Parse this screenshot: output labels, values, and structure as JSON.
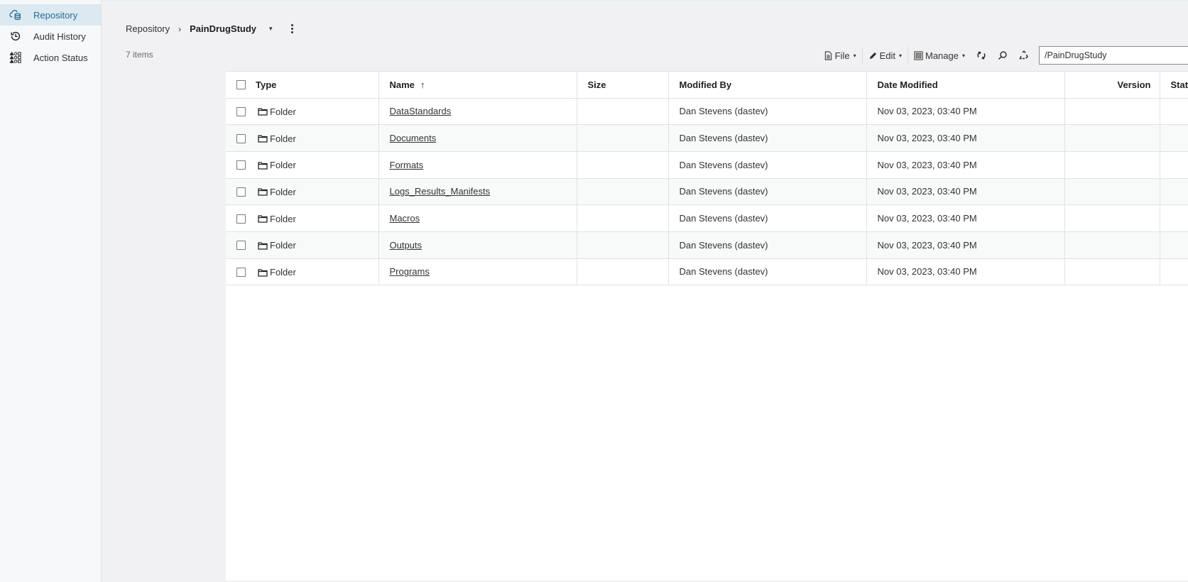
{
  "sidebar": {
    "items": [
      {
        "label": "Repository",
        "icon": "cloud-database-icon",
        "active": true
      },
      {
        "label": "Audit History",
        "icon": "history-icon",
        "active": false
      },
      {
        "label": "Action Status",
        "icon": "action-status-grid-icon",
        "active": false
      }
    ]
  },
  "breadcrumb": {
    "root": "Repository",
    "separator": "›",
    "current": "PainDrugStudy",
    "dropdown_glyph": "▾"
  },
  "item_count": "7 items",
  "toolbar": {
    "file_label": "File",
    "edit_label": "Edit",
    "manage_label": "Manage",
    "caret": "▾",
    "path_value": "/PainDrugStudy",
    "icons": [
      "sync-icon",
      "search-icon",
      "recycle-icon"
    ]
  },
  "table": {
    "columns": {
      "type": "Type",
      "name": "Name",
      "name_sort": "↑",
      "size": "Size",
      "modified_by": "Modified By",
      "date_modified": "Date Modified",
      "version": "Version",
      "status": "Status"
    },
    "rows": [
      {
        "type": "Folder",
        "name": "DataStandards",
        "size": "",
        "modified_by": "Dan Stevens (dastev)",
        "date_modified": "Nov 03, 2023, 03:40 PM",
        "version": "",
        "status": ""
      },
      {
        "type": "Folder",
        "name": "Documents",
        "size": "",
        "modified_by": "Dan Stevens (dastev)",
        "date_modified": "Nov 03, 2023, 03:40 PM",
        "version": "",
        "status": ""
      },
      {
        "type": "Folder",
        "name": "Formats",
        "size": "",
        "modified_by": "Dan Stevens (dastev)",
        "date_modified": "Nov 03, 2023, 03:40 PM",
        "version": "",
        "status": ""
      },
      {
        "type": "Folder",
        "name": "Logs_Results_Manifests",
        "size": "",
        "modified_by": "Dan Stevens (dastev)",
        "date_modified": "Nov 03, 2023, 03:40 PM",
        "version": "",
        "status": ""
      },
      {
        "type": "Folder",
        "name": "Macros",
        "size": "",
        "modified_by": "Dan Stevens (dastev)",
        "date_modified": "Nov 03, 2023, 03:40 PM",
        "version": "",
        "status": ""
      },
      {
        "type": "Folder",
        "name": "Outputs",
        "size": "",
        "modified_by": "Dan Stevens (dastev)",
        "date_modified": "Nov 03, 2023, 03:40 PM",
        "version": "",
        "status": ""
      },
      {
        "type": "Folder",
        "name": "Programs",
        "size": "",
        "modified_by": "Dan Stevens (dastev)",
        "date_modified": "Nov 03, 2023, 03:40 PM",
        "version": "",
        "status": ""
      }
    ]
  },
  "colors": {
    "accent": "#2b6a93",
    "active_nav_bg": "#dbe9f1"
  }
}
